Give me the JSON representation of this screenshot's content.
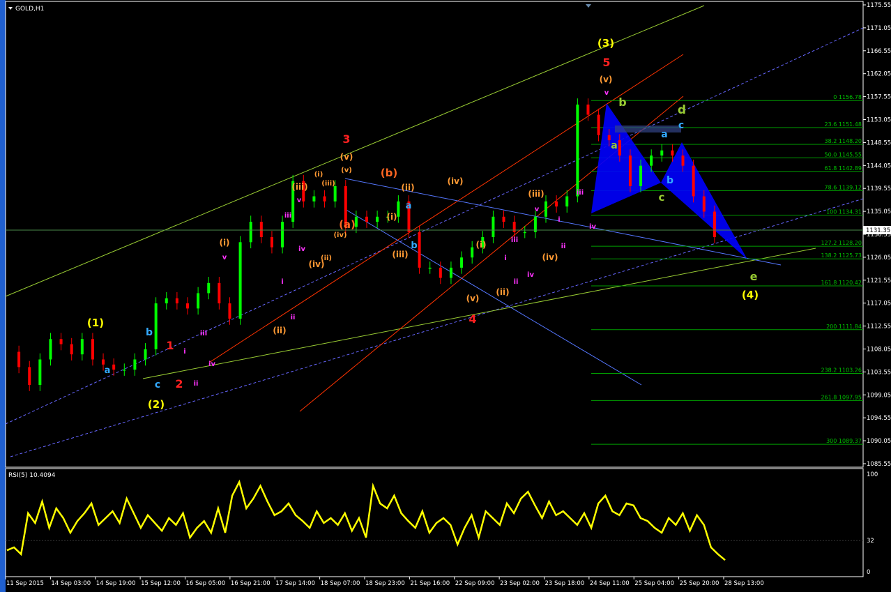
{
  "symbol": "GOLD,H1",
  "rsi_label": "RSI(5) 10.4094",
  "current_price": "1131.35",
  "colors": {
    "background": "#000000",
    "bull": "#00ff00",
    "bear": "#ff0000",
    "rsi": "#ffff00",
    "fib": "#00a000",
    "pattern": "#0000ff",
    "channel_green": "#99cc33",
    "channel_blue": "#6666ff",
    "channel_red": "#ff3300",
    "trend_lightblue": "#5577ff"
  },
  "price_axis": [
    "1175.55",
    "1171.05",
    "1166.55",
    "1162.05",
    "1157.55",
    "1153.05",
    "1148.55",
    "1144.05",
    "1139.55",
    "1135.05",
    "1130.55",
    "1126.05",
    "1121.55",
    "1117.05",
    "1112.55",
    "1108.05",
    "1103.55",
    "1099.05",
    "1094.55",
    "1090.05",
    "1085.55"
  ],
  "rsi_axis": [
    "100",
    "32",
    "0"
  ],
  "time_axis": [
    "11 Sep 2015",
    "14 Sep 03:00",
    "14 Sep 19:00",
    "15 Sep 12:00",
    "16 Sep 05:00",
    "16 Sep 21:00",
    "17 Sep 14:00",
    "18 Sep 07:00",
    "18 Sep 23:00",
    "21 Sep 16:00",
    "22 Sep 09:00",
    "23 Sep 02:00",
    "23 Sep 18:00",
    "24 Sep 11:00",
    "25 Sep 04:00",
    "25 Sep 20:00",
    "28 Sep 13:00"
  ],
  "fib_levels": [
    {
      "ratio": "0",
      "price": "1156.78"
    },
    {
      "ratio": "23.6",
      "price": "1151.48"
    },
    {
      "ratio": "38.2",
      "price": "1148.20"
    },
    {
      "ratio": "50.0",
      "price": "1145.55"
    },
    {
      "ratio": "61.8",
      "price": "1142.89"
    },
    {
      "ratio": "78.6",
      "price": "1139.12"
    },
    {
      "ratio": "100",
      "price": "1134.31"
    },
    {
      "ratio": "127.2",
      "price": "1128.20"
    },
    {
      "ratio": "138.2",
      "price": "1125.73"
    },
    {
      "ratio": "161.8",
      "price": "1120.42"
    },
    {
      "ratio": "200",
      "price": "1111.84"
    },
    {
      "ratio": "238.2",
      "price": "1103.26"
    },
    {
      "ratio": "261.8",
      "price": "1097.95"
    },
    {
      "ratio": "300",
      "price": "1089.37"
    }
  ],
  "labels": [
    {
      "t": "(1)",
      "c": "#ffff00"
    },
    {
      "t": "(2)",
      "c": "#ffff00"
    },
    {
      "t": "(3)",
      "c": "#ffff00"
    },
    {
      "t": "(4)",
      "c": "#ffff00"
    },
    {
      "t": "a",
      "c": "#33aaff"
    },
    {
      "t": "b",
      "c": "#33aaff"
    },
    {
      "t": "c",
      "c": "#33aaff"
    },
    {
      "t": "1",
      "c": "#ff2020"
    },
    {
      "t": "2",
      "c": "#ff2020"
    },
    {
      "t": "3",
      "c": "#ff2020"
    },
    {
      "t": "4",
      "c": "#ff2020"
    },
    {
      "t": "5",
      "c": "#ff2020"
    },
    {
      "t": "i",
      "c": "#ff33ff"
    },
    {
      "t": "ii",
      "c": "#ff33ff"
    },
    {
      "t": "iii",
      "c": "#ff33ff"
    },
    {
      "t": "iv",
      "c": "#ff33ff"
    },
    {
      "t": "v",
      "c": "#ff33ff"
    },
    {
      "t": "(i)",
      "c": "#ff9933"
    },
    {
      "t": "(ii)",
      "c": "#ff9933"
    },
    {
      "t": "(iii)",
      "c": "#ff9933"
    },
    {
      "t": "(iv)",
      "c": "#ff9933"
    },
    {
      "t": "(v)",
      "c": "#ff9933"
    },
    {
      "t": "(a)",
      "c": "#ff6622"
    },
    {
      "t": "(b)",
      "c": "#ff6622"
    },
    {
      "t": "i",
      "c": "#ff33ff"
    },
    {
      "t": "ii",
      "c": "#ff33ff"
    },
    {
      "t": "iii",
      "c": "#ff33ff"
    },
    {
      "t": "iv",
      "c": "#ff33ff"
    },
    {
      "t": "v",
      "c": "#ff33ff"
    },
    {
      "t": "(i)",
      "c": "#ff9933"
    },
    {
      "t": "(ii)",
      "c": "#ff9933"
    },
    {
      "t": "(iii)",
      "c": "#ff9933"
    },
    {
      "t": "(iv)",
      "c": "#ff9933"
    },
    {
      "t": "(v)",
      "c": "#ff9933"
    },
    {
      "t": "a",
      "c": "#33aaff"
    },
    {
      "t": "b",
      "c": "#33aaff"
    },
    {
      "t": "(i)",
      "c": "#ff9933"
    },
    {
      "t": "(ii)",
      "c": "#ff9933"
    },
    {
      "t": "(iii)",
      "c": "#ff9933"
    },
    {
      "t": "(iv)",
      "c": "#ff9933"
    },
    {
      "t": "(v)",
      "c": "#ff9933"
    },
    {
      "t": "i",
      "c": "#ff33ff"
    },
    {
      "t": "ii",
      "c": "#ff33ff"
    },
    {
      "t": "iii",
      "c": "#ff33ff"
    },
    {
      "t": "iv",
      "c": "#ff33ff"
    },
    {
      "t": "v",
      "c": "#ff33ff"
    },
    {
      "t": "(i)",
      "c": "#ff9933"
    },
    {
      "t": "(ii)",
      "c": "#ff9933"
    },
    {
      "t": "(iii)",
      "c": "#ff9933"
    },
    {
      "t": "(iv)",
      "c": "#ff9933"
    },
    {
      "t": "(v)",
      "c": "#ff9933"
    },
    {
      "t": "i",
      "c": "#ff33ff"
    },
    {
      "t": "ii",
      "c": "#ff33ff"
    },
    {
      "t": "iii",
      "c": "#ff33ff"
    },
    {
      "t": "iv",
      "c": "#ff33ff"
    },
    {
      "t": "v",
      "c": "#ff33ff"
    },
    {
      "t": "a",
      "c": "#99cc33"
    },
    {
      "t": "b",
      "c": "#99cc33"
    },
    {
      "t": "c",
      "c": "#99cc33"
    },
    {
      "t": "d",
      "c": "#99cc33"
    },
    {
      "t": "e",
      "c": "#99cc33"
    },
    {
      "t": "a",
      "c": "#33aaff"
    },
    {
      "t": "b",
      "c": "#33aaff"
    },
    {
      "t": "c",
      "c": "#33aaff"
    }
  ],
  "chart_data": {
    "type": "candlestick",
    "title": "GOLD,H1",
    "ylim": [
      1085.55,
      1175.55
    ],
    "x": [
      "11 Sep 2015",
      "14 Sep 03:00",
      "14 Sep 19:00",
      "15 Sep 12:00",
      "16 Sep 05:00",
      "16 Sep 21:00",
      "17 Sep 14:00",
      "18 Sep 07:00",
      "18 Sep 23:00",
      "21 Sep 16:00",
      "22 Sep 09:00",
      "23 Sep 02:00",
      "23 Sep 18:00",
      "24 Sep 11:00",
      "25 Sep 04:00",
      "25 Sep 20:00",
      "28 Sep 13:00"
    ],
    "close_series": [
      1107.5,
      1104.5,
      1101,
      1106,
      1110,
      1109,
      1107,
      1110,
      1106,
      1105,
      1104,
      1104,
      1106,
      1108,
      1117,
      1118,
      1117,
      1116,
      1119,
      1121,
      1117,
      1114,
      1129,
      1133,
      1130,
      1128,
      1133,
      1141,
      1137,
      1138,
      1137,
      1140,
      1132,
      1134,
      1133,
      1134,
      1134,
      1137,
      1131,
      1124,
      1124,
      1122,
      1124,
      1126,
      1128,
      1130,
      1134,
      1133,
      1131,
      1131,
      1134,
      1137,
      1136,
      1138,
      1156,
      1154,
      1150,
      1149,
      1146,
      1140,
      1144,
      1146,
      1147,
      1146,
      1144,
      1138,
      1135,
      1130
    ],
    "rsi": {
      "name": "RSI(5) 10.4094",
      "ylim": [
        0,
        100
      ],
      "levels": [
        32
      ],
      "values": [
        22,
        25,
        18,
        60,
        50,
        72,
        45,
        65,
        55,
        40,
        52,
        60,
        70,
        48,
        55,
        62,
        50,
        75,
        60,
        45,
        58,
        50,
        42,
        55,
        48,
        60,
        35,
        45,
        52,
        40,
        65,
        40,
        78,
        92,
        65,
        75,
        88,
        72,
        58,
        62,
        70,
        58,
        52,
        45,
        62,
        50,
        55,
        48,
        60,
        42,
        55,
        35,
        88,
        70,
        65,
        78,
        60,
        52,
        45,
        62,
        40,
        50,
        55,
        48,
        28,
        45,
        58,
        35,
        62,
        55,
        48,
        70,
        60,
        75,
        82,
        68,
        55,
        72,
        58,
        62,
        55,
        48,
        60,
        45,
        70,
        78,
        62,
        58,
        70,
        68,
        55,
        52,
        45,
        40,
        55,
        48,
        60,
        42,
        58,
        48,
        25,
        18,
        12
      ]
    },
    "fibonacci": [
      {
        "ratio": "0",
        "price": 1156.78
      },
      {
        "ratio": "23.6",
        "price": 1151.48
      },
      {
        "ratio": "38.2",
        "price": 1148.2
      },
      {
        "ratio": "50.0",
        "price": 1145.55
      },
      {
        "ratio": "61.8",
        "price": 1142.89
      },
      {
        "ratio": "78.6",
        "price": 1139.12
      },
      {
        "ratio": "100",
        "price": 1134.31
      },
      {
        "ratio": "127.2",
        "price": 1128.2
      },
      {
        "ratio": "138.2",
        "price": 1125.73
      },
      {
        "ratio": "161.8",
        "price": 1120.42
      },
      {
        "ratio": "200",
        "price": 1111.84
      },
      {
        "ratio": "238.2",
        "price": 1103.26
      },
      {
        "ratio": "261.8",
        "price": 1097.95
      },
      {
        "ratio": "300",
        "price": 1089.37
      }
    ],
    "current_price": 1131.35
  }
}
